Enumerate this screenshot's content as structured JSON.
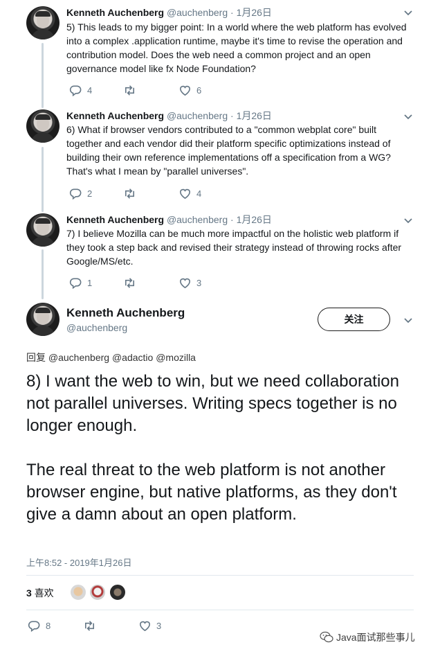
{
  "colors": {
    "text": "#14171a",
    "muted": "#657786",
    "line": "#ccd6dd"
  },
  "thread": [
    {
      "name": "Kenneth Auchenberg",
      "handle": "@auchenberg",
      "date": "1月26日",
      "separator": "·",
      "lines": [
        "5) This leads to my bigger point: In a world where the web platform has evolved",
        "into a complex .application runtime, maybe it's time to revise the operation and",
        "contribution model. Does the web need a common project and an open",
        "governance model like fx Node Foundation?"
      ],
      "replies": "4",
      "retweets": "",
      "likes": "6"
    },
    {
      "name": "Kenneth Auchenberg",
      "handle": "@auchenberg",
      "date": "1月26日",
      "separator": "·",
      "lines": [
        "6) What if browser vendors contributed to a \"common webplat core\" built",
        "together and each vendor did their platform specific optimizations instead of",
        "building their own reference implementations off a specification from a WG?",
        "That's what I mean by \"parallel universes\"."
      ],
      "replies": "2",
      "retweets": "",
      "likes": "4"
    },
    {
      "name": "Kenneth Auchenberg",
      "handle": "@auchenberg",
      "date": "1月26日",
      "separator": "·",
      "lines": [
        "7) I believe Mozilla can be much more impactful on the holistic web platform if",
        "they took a step back and revised their strategy instead of throwing rocks after",
        "Google/MS/etc."
      ],
      "replies": "1",
      "retweets": "",
      "likes": "3"
    }
  ],
  "main_tweet": {
    "name": "Kenneth Auchenberg",
    "handle": "@auchenberg",
    "follow_label": "关注",
    "reply_prefix": "回复",
    "reply_to": "@auchenberg @adactio @mozilla",
    "paragraph1": "8) I want the web to win, but we need collaboration not parallel universes. Writing specs together is no longer enough.",
    "paragraph2": "The real threat to the web platform is not another browser engine, but native platforms, as they don't give a damn about an open platform.",
    "timestamp": "上午8:52 - 2019年1月26日",
    "likes_number": "3",
    "likes_label": "喜欢",
    "replies": "8",
    "likes": "3"
  },
  "watermark": {
    "text": "Java面试那些事儿"
  },
  "icons": [
    "reply-icon",
    "retweet-icon",
    "heart-icon",
    "chevron-down-icon",
    "wechat-logo-icon"
  ]
}
